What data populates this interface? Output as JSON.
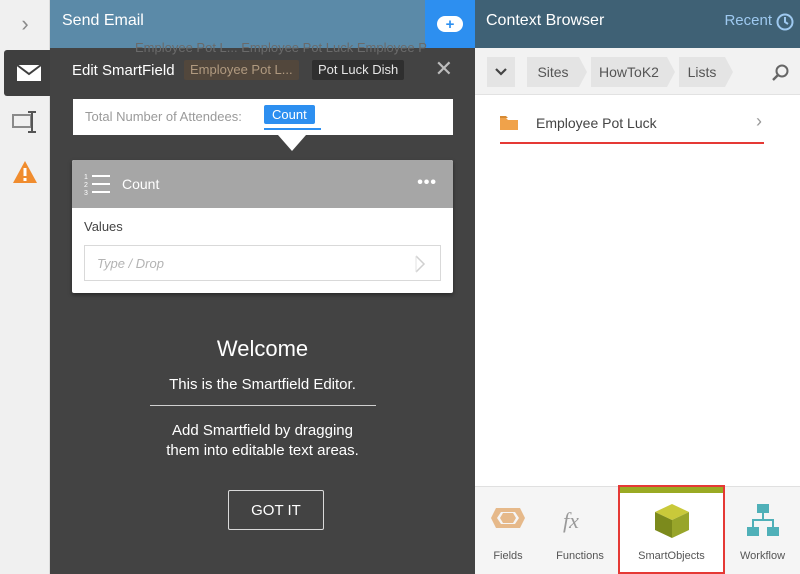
{
  "left_rail": {
    "expand_icon": "chevron-right-icon",
    "tools": [
      "email-icon",
      "editor-toggle-icon",
      "warning-icon"
    ],
    "colors": {
      "warning": "#f08c2e"
    }
  },
  "header": {
    "title": "Send Email",
    "action_icon": "add-token-icon"
  },
  "editor": {
    "title": "Edit SmartField",
    "ghost_text": "Employee Pot L...  Employee Pot Luck  Employee P",
    "tokens": [
      "Employee Pot L...",
      "Pot Luck Dish"
    ],
    "field_label": "Total Number of Attendees:",
    "field_chip": "Count",
    "card": {
      "title": "Count",
      "more": "•••",
      "values_label": "Values",
      "values_placeholder": "Type / Drop"
    },
    "welcome": {
      "title": "Welcome",
      "line1": "This is the Smartfield Editor.",
      "line2a": "Add Smartfield by dragging",
      "line2b": "them into editable text areas.",
      "button": "GOT IT"
    }
  },
  "context_browser": {
    "title": "Context Browser",
    "recent": "Recent",
    "breadcrumbs": [
      "Sites",
      "HowToK2",
      "Lists"
    ],
    "items": [
      {
        "label": "Employee Pot Luck",
        "icon": "folder-icon"
      }
    ],
    "tabs": [
      {
        "label": "Fields",
        "icon": "fields-icon"
      },
      {
        "label": "Functions",
        "icon": "functions-icon"
      },
      {
        "label": "SmartObjects",
        "icon": "smartobjects-icon",
        "selected": true
      },
      {
        "label": "Workflow",
        "icon": "workflow-icon"
      }
    ],
    "colors": {
      "accent": "#2d8ff0",
      "selected_bar": "#9aaa23",
      "highlight": "#e53935"
    }
  }
}
